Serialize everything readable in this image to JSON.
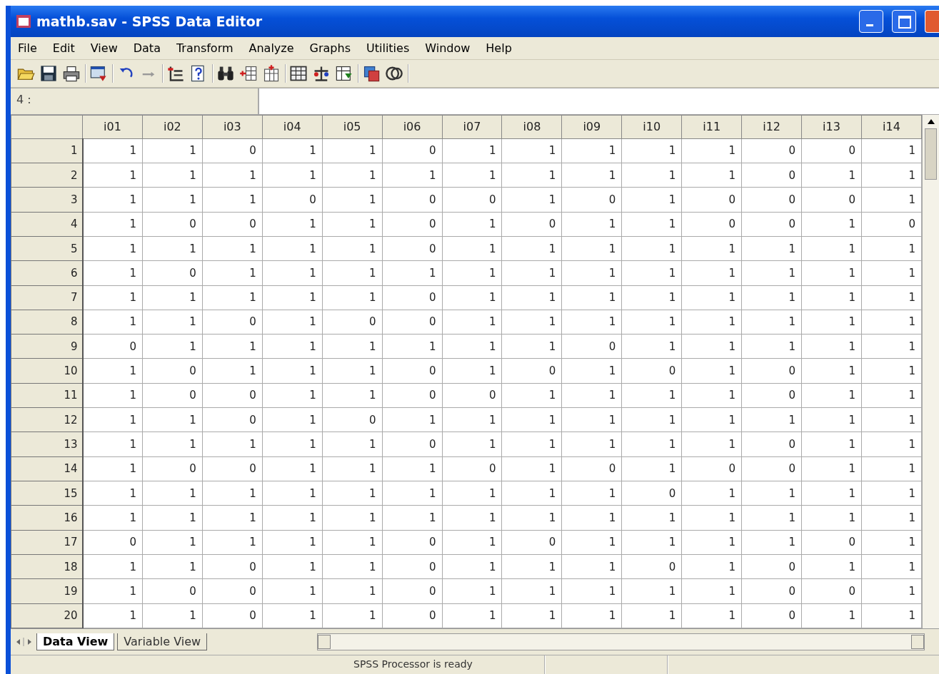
{
  "window": {
    "title": "mathb.sav - SPSS Data Editor"
  },
  "menu": [
    "File",
    "Edit",
    "View",
    "Data",
    "Transform",
    "Analyze",
    "Graphs",
    "Utilities",
    "Window",
    "Help"
  ],
  "cell_editor": {
    "cell": "4 :"
  },
  "table": {
    "columns": [
      "i01",
      "i02",
      "i03",
      "i04",
      "i05",
      "i06",
      "i07",
      "i08",
      "i09",
      "i10",
      "i11",
      "i12",
      "i13",
      "i14"
    ],
    "rows": [
      {
        "case": "1",
        "values": [
          "1",
          "1",
          "0",
          "1",
          "1",
          "0",
          "1",
          "1",
          "1",
          "1",
          "1",
          "0",
          "0",
          "1"
        ]
      },
      {
        "case": "2",
        "values": [
          "1",
          "1",
          "1",
          "1",
          "1",
          "1",
          "1",
          "1",
          "1",
          "1",
          "1",
          "0",
          "1",
          "1"
        ]
      },
      {
        "case": "3",
        "values": [
          "1",
          "1",
          "1",
          "0",
          "1",
          "0",
          "0",
          "1",
          "0",
          "1",
          "0",
          "0",
          "0",
          "1"
        ]
      },
      {
        "case": "4",
        "values": [
          "1",
          "0",
          "0",
          "1",
          "1",
          "0",
          "1",
          "0",
          "1",
          "1",
          "0",
          "0",
          "1",
          "0"
        ]
      },
      {
        "case": "5",
        "values": [
          "1",
          "1",
          "1",
          "1",
          "1",
          "0",
          "1",
          "1",
          "1",
          "1",
          "1",
          "1",
          "1",
          "1"
        ]
      },
      {
        "case": "6",
        "values": [
          "1",
          "0",
          "1",
          "1",
          "1",
          "1",
          "1",
          "1",
          "1",
          "1",
          "1",
          "1",
          "1",
          "1"
        ]
      },
      {
        "case": "7",
        "values": [
          "1",
          "1",
          "1",
          "1",
          "1",
          "0",
          "1",
          "1",
          "1",
          "1",
          "1",
          "1",
          "1",
          "1"
        ]
      },
      {
        "case": "8",
        "values": [
          "1",
          "1",
          "0",
          "1",
          "0",
          "0",
          "1",
          "1",
          "1",
          "1",
          "1",
          "1",
          "1",
          "1"
        ]
      },
      {
        "case": "9",
        "values": [
          "0",
          "1",
          "1",
          "1",
          "1",
          "1",
          "1",
          "1",
          "0",
          "1",
          "1",
          "1",
          "1",
          "1"
        ]
      },
      {
        "case": "10",
        "values": [
          "1",
          "0",
          "1",
          "1",
          "1",
          "0",
          "1",
          "0",
          "1",
          "0",
          "1",
          "0",
          "1",
          "1"
        ]
      },
      {
        "case": "11",
        "values": [
          "1",
          "0",
          "0",
          "1",
          "1",
          "0",
          "0",
          "1",
          "1",
          "1",
          "1",
          "0",
          "1",
          "1"
        ]
      },
      {
        "case": "12",
        "values": [
          "1",
          "1",
          "0",
          "1",
          "0",
          "1",
          "1",
          "1",
          "1",
          "1",
          "1",
          "1",
          "1",
          "1"
        ]
      },
      {
        "case": "13",
        "values": [
          "1",
          "1",
          "1",
          "1",
          "1",
          "0",
          "1",
          "1",
          "1",
          "1",
          "1",
          "0",
          "1",
          "1"
        ]
      },
      {
        "case": "14",
        "values": [
          "1",
          "0",
          "0",
          "1",
          "1",
          "1",
          "0",
          "1",
          "0",
          "1",
          "0",
          "0",
          "1",
          "1"
        ]
      },
      {
        "case": "15",
        "values": [
          "1",
          "1",
          "1",
          "1",
          "1",
          "1",
          "1",
          "1",
          "1",
          "0",
          "1",
          "1",
          "1",
          "1"
        ]
      },
      {
        "case": "16",
        "values": [
          "1",
          "1",
          "1",
          "1",
          "1",
          "1",
          "1",
          "1",
          "1",
          "1",
          "1",
          "1",
          "1",
          "1"
        ]
      },
      {
        "case": "17",
        "values": [
          "0",
          "1",
          "1",
          "1",
          "1",
          "0",
          "1",
          "0",
          "1",
          "1",
          "1",
          "1",
          "0",
          "1"
        ]
      },
      {
        "case": "18",
        "values": [
          "1",
          "1",
          "0",
          "1",
          "1",
          "0",
          "1",
          "1",
          "1",
          "0",
          "1",
          "0",
          "1",
          "1"
        ]
      },
      {
        "case": "19",
        "values": [
          "1",
          "0",
          "0",
          "1",
          "1",
          "0",
          "1",
          "1",
          "1",
          "1",
          "1",
          "0",
          "0",
          "1"
        ]
      },
      {
        "case": "20",
        "values": [
          "1",
          "1",
          "0",
          "1",
          "1",
          "0",
          "1",
          "1",
          "1",
          "1",
          "1",
          "0",
          "1",
          "1"
        ]
      }
    ]
  },
  "tabs": [
    {
      "label": "Data View",
      "selected": true
    },
    {
      "label": "Variable View",
      "selected": false
    }
  ],
  "status_bar": {
    "message": "SPSS Processor  is ready"
  }
}
